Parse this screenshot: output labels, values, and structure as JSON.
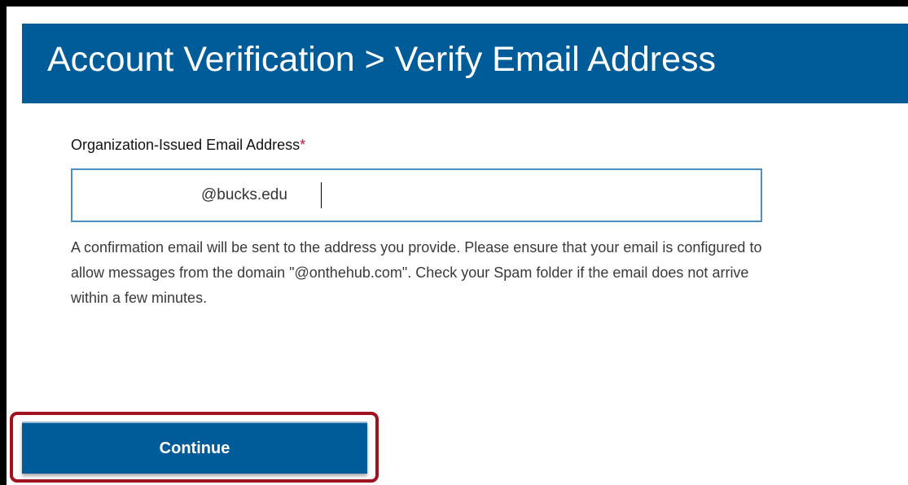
{
  "header": {
    "title": "Account Verification > Verify Email Address"
  },
  "form": {
    "email_label": "Organization-Issued Email Address",
    "required_marker": "*",
    "email_value": "@bucks.edu",
    "help_text": "A confirmation email will be sent to the address you provide. Please ensure that your email is configured to allow messages from the domain \"@onthehub.com\". Check your Spam folder if the email does not arrive within a few minutes.",
    "continue_label": "Continue"
  },
  "colors": {
    "brand_blue": "#005b99",
    "required_red": "#c8102e",
    "highlight_red": "#a0121f",
    "input_border": "#4a90c8"
  }
}
